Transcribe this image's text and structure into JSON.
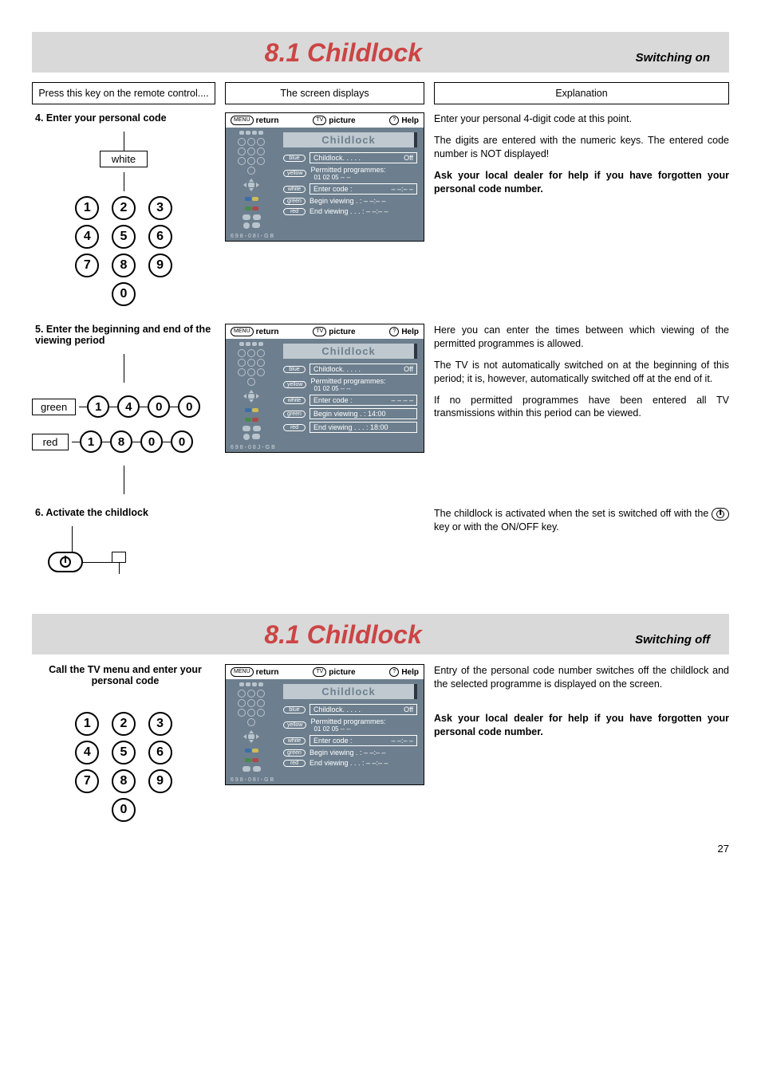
{
  "section_on": {
    "title": "8.1 Childlock",
    "subtitle": "Switching on",
    "header_col1": "Press this key on the remote control....",
    "header_col2": "The screen displays",
    "header_col3": "Explanation",
    "step4": {
      "label": "4. Enter your personal code",
      "remote_label": "white",
      "keys_row1": [
        "1",
        "2",
        "3"
      ],
      "keys_row2": [
        "4",
        "5",
        "6"
      ],
      "keys_row3": [
        "7",
        "8",
        "9"
      ],
      "keys_row4": [
        "0"
      ],
      "explain_p1": "Enter your personal 4-digit code at this point.",
      "explain_p2": "The digits are entered with the numeric keys. The entered code number is NOT displayed!",
      "explain_p3": "Ask your local dealer for help if you have forgotten your personal code number."
    },
    "step5": {
      "label": "5. Enter the beginning and end of the viewing period",
      "seq1_label": "green",
      "seq1_keys": [
        "1",
        "4",
        "0",
        "0"
      ],
      "seq2_label": "red",
      "seq2_keys": [
        "1",
        "8",
        "0",
        "0"
      ],
      "explain_p1": "Here you can enter the times between which viewing of the permitted programmes is allowed.",
      "explain_p2": "The TV is not automatically switched on at the beginning of this period; it is, however, automatically switched off at the end of it.",
      "explain_p3": "If no permitted programmes have been entered all TV transmissions within this period can be viewed."
    },
    "step6": {
      "label": "6. Activate the childlock",
      "explain_pre": "The childlock is activated when the set is switched off with the ",
      "explain_post": " key or with the ON/OFF key."
    },
    "osd_topbar": {
      "menu_pill": "MENU",
      "return": "return",
      "tv_pill": "TV",
      "picture": "picture",
      "q_pill": "?",
      "help": "Help"
    },
    "osd1": {
      "title": "Childlock",
      "foot": "698-08I-GB",
      "line_blue": {
        "pill": "blue",
        "label": "Childlock. . . . .",
        "value": "Off"
      },
      "line_yellow": {
        "pill": "yellow",
        "label": "Permitted programmes:",
        "sub": "01  02  05  --  --"
      },
      "line_white": {
        "pill": "white",
        "label": "Enter code  :",
        "value": "– –:– –"
      },
      "line_green": {
        "pill": "green",
        "label": "Begin viewing . : – –:– –"
      },
      "line_red": {
        "pill": "red",
        "label": "End viewing . . . : – –:– –"
      }
    },
    "osd2": {
      "title": "Childlock",
      "foot": "698-08J-GB",
      "line_blue": {
        "pill": "blue",
        "label": "Childlock. . . . .",
        "value": "Off"
      },
      "line_yellow": {
        "pill": "yellow",
        "label": "Permitted programmes:",
        "sub": "01  02  05  --  --"
      },
      "line_white": {
        "pill": "white",
        "label": "Enter code  :",
        "value": "– – – –"
      },
      "line_green": {
        "pill": "green",
        "label": "Begin viewing . : 14:00"
      },
      "line_red": {
        "pill": "red",
        "label": "End viewing . . . : 18:00"
      }
    }
  },
  "section_off": {
    "title": "8.1 Childlock",
    "subtitle": "Switching off",
    "step": {
      "label": "Call the TV menu and enter your personal code",
      "keys_row1": [
        "1",
        "2",
        "3"
      ],
      "keys_row2": [
        "4",
        "5",
        "6"
      ],
      "keys_row3": [
        "7",
        "8",
        "9"
      ],
      "keys_row4": [
        "0"
      ],
      "explain_p1": "Entry of the personal code number switches off the childlock and the selected programme is displayed on the screen.",
      "explain_p2": "Ask your local dealer for help if you have forgotten your personal code number."
    },
    "osd": {
      "title": "Childlock",
      "foot": "698-08I-GB",
      "line_blue": {
        "pill": "blue",
        "label": "Childlock. . . . .",
        "value": "Off"
      },
      "line_yellow": {
        "pill": "yellow",
        "label": "Permitted programmes:",
        "sub": "01  02  05  --  --"
      },
      "line_white": {
        "pill": "white",
        "label": "Enter code  :",
        "value": "– –:– –"
      },
      "line_green": {
        "pill": "green",
        "label": "Begin viewing . : – –:– –"
      },
      "line_red": {
        "pill": "red",
        "label": "End viewing . . . : – –:– –"
      }
    }
  },
  "page_number": "27"
}
